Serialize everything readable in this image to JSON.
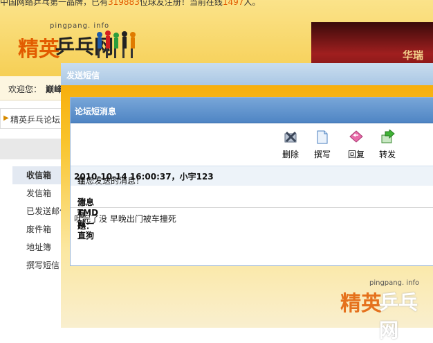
{
  "page": {
    "marquee_pre": "中国网络乒乓第一品牌，已有",
    "marquee_count": "319883",
    "marquee_mid": "位球友注册！当前在线",
    "marquee_online": "1497",
    "marquee_post": "人。",
    "logo_en": "pingpang. info",
    "logo_cn_1": "精英",
    "logo_cn_2": "乒乓网",
    "banner_text": "华瑞",
    "welcome_label": "欢迎您：",
    "welcome_user": "巅峰",
    "crumb_text": "精英乒乓论坛"
  },
  "sidebar": {
    "items": [
      {
        "label": "收信箱",
        "active": true
      },
      {
        "label": "发信箱"
      },
      {
        "label": "已发送邮件"
      },
      {
        "label": "废件箱"
      },
      {
        "label": "地址簿"
      },
      {
        "label": "撰写短信"
      }
    ]
  },
  "modal": {
    "title": "发送短信",
    "panel_title": "论坛短消息",
    "toolbar": {
      "delete": "删除",
      "compose": "撰写",
      "reply": "回复",
      "forward": "转发"
    },
    "info_pre": "在",
    "info_time": "2010-10-14 16:00:37",
    "info_sep": "，",
    "info_sender": "小宇123",
    "info_post": "给您发送的消息！",
    "subject_label": "消息标题：",
    "subject": "你TMD就一直狗",
    "body": "吠完了没 早晚出门被车撞死"
  },
  "colors": {
    "accent": "#4f85c4",
    "modal_bg": "#f9c42c",
    "logo_orange": "#e25c00"
  }
}
